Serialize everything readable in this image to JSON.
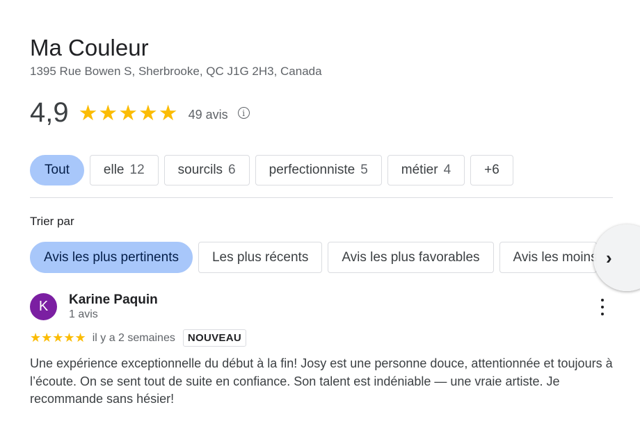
{
  "place": {
    "name": "Ma Couleur",
    "address": "1395 Rue Bowen S, Sherbrooke, QC J1G 2H3, Canada",
    "rating": "4,9",
    "stars_text": "★★★★★",
    "review_count": "49 avis",
    "info_icon": "ⓘ"
  },
  "topic_chips": [
    {
      "label": "Tout",
      "count": "",
      "active": true
    },
    {
      "label": "elle",
      "count": "12",
      "active": false
    },
    {
      "label": "sourcils",
      "count": "6",
      "active": false
    },
    {
      "label": "perfectionniste",
      "count": "5",
      "active": false
    },
    {
      "label": "métier",
      "count": "4",
      "active": false
    },
    {
      "label": "+6",
      "count": "",
      "active": false
    }
  ],
  "sort": {
    "label": "Trier par",
    "options": [
      {
        "label": "Avis les plus pertinents",
        "active": true
      },
      {
        "label": "Les plus récents",
        "active": false
      },
      {
        "label": "Avis les plus favorables",
        "active": false
      },
      {
        "label": "Avis les moins favorables",
        "active": false
      }
    ],
    "next_icon": "›"
  },
  "review": {
    "avatar_initial": "K",
    "author": "Karine Paquin",
    "author_meta": "1 avis",
    "stars_text": "★★★★★",
    "date": "il y a 2 semaines",
    "badge": "NOUVEAU",
    "text": "Une expérience exceptionnelle du début à la fin! Josy est une personne douce, attentionnée et toujours à l’écoute. On se sent tout de suite en confiance. Son talent est indéniable — une vraie artiste. Je recommande sans hésier!"
  },
  "colors": {
    "accent_chip": "#a8c7fa",
    "star": "#fbbc04",
    "avatar": "#7b1fa2"
  }
}
